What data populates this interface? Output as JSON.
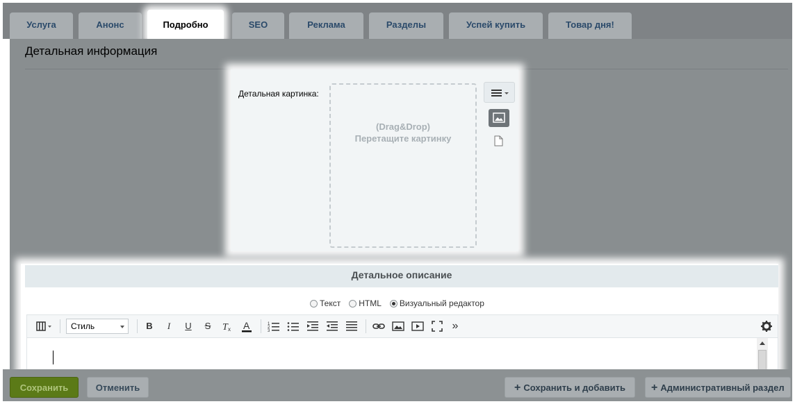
{
  "tabs": [
    {
      "label": "Услуга"
    },
    {
      "label": "Анонс"
    },
    {
      "label": "Подробно"
    },
    {
      "label": "SEO"
    },
    {
      "label": "Реклама"
    },
    {
      "label": "Разделы"
    },
    {
      "label": "Успей купить"
    },
    {
      "label": "Товар дня!"
    }
  ],
  "active_tab": "Подробно",
  "section": {
    "title": "Детальная информация"
  },
  "picture": {
    "label": "Детальная картинка:",
    "drop_line1": "(Drag&Drop)",
    "drop_line2": "Перетащите картинку"
  },
  "description": {
    "header": "Детальное описание",
    "modes": [
      {
        "label": "Текст",
        "selected": false
      },
      {
        "label": "HTML",
        "selected": false
      },
      {
        "label": "Визуальный редактор",
        "selected": true
      }
    ],
    "style_select": "Стиль",
    "toolbar_icons": [
      "snippets-icon",
      "bold-icon",
      "italic-icon",
      "underline-icon",
      "strikethrough-icon",
      "remove-format-icon",
      "font-color-icon",
      "ordered-list-icon",
      "unordered-list-icon",
      "indent-icon",
      "outdent-icon",
      "justify-icon",
      "link-icon",
      "image-icon",
      "video-icon",
      "fullscreen-icon",
      "more-icon",
      "settings-icon"
    ],
    "bold_glyph": "B",
    "italic_glyph": "I",
    "underline_glyph": "U",
    "strike_glyph": "S",
    "more_glyph": "»"
  },
  "footer": {
    "save": "Сохранить",
    "cancel": "Отменить",
    "save_add": "Сохранить и добавить",
    "admin": "Административный раздел"
  },
  "colors": {
    "overlay": "#898e90",
    "save_button": "#5b7a17",
    "tab_text": "#2b4a6a"
  }
}
